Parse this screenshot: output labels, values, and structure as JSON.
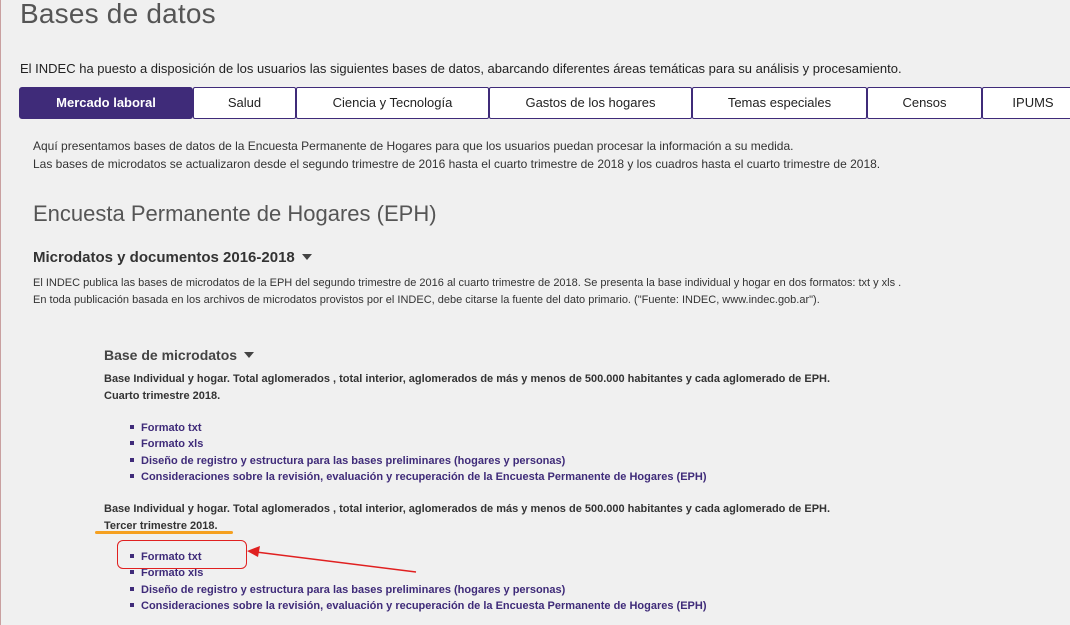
{
  "page": {
    "title": "Bases de datos",
    "intro": "El INDEC ha puesto a disposición de los usuarios las siguientes bases de datos, abarcando diferentes áreas temáticas para su análisis y procesamiento."
  },
  "tabs": [
    {
      "label": "Mercado laboral",
      "active": true
    },
    {
      "label": "Salud"
    },
    {
      "label": "Ciencia y Tecnología"
    },
    {
      "label": "Gastos de los hogares"
    },
    {
      "label": "Temas especiales"
    },
    {
      "label": "Censos"
    },
    {
      "label": "IPUMS"
    }
  ],
  "lead": {
    "line1": "Aquí presentamos bases de datos de la Encuesta Permanente de Hogares para que los usuarios puedan procesar la información a su medida.",
    "line2": "Las bases de microdatos se actualizaron desde el segundo trimestre de 2016 hasta el cuarto trimestre de 2018 y los cuadros hasta el cuarto trimestre de 2018."
  },
  "section": {
    "title": "Encuesta Permanente de Hogares (EPH)",
    "subsection_title": "Microdatos y documentos 2016-2018",
    "subsection_desc": "El INDEC publica las bases de microdatos de la EPH del segundo trimestre de 2016 al cuarto trimestre de 2018. Se presenta la base individual y hogar en dos formatos: txt y xls . En toda publicación basada en los archivos de microdatos provistos por el INDEC, debe citarse la fuente del dato primario. (\"Fuente: INDEC, www.indec.gob.ar\")."
  },
  "microdatos": {
    "heading": "Base de microdatos",
    "blocks": [
      {
        "description": "Base Individual y hogar. Total aglomerados , total interior, aglomerados de más y menos de 500.000 habitantes y cada aglomerado de EPH.",
        "period": "Cuarto trimestre 2018.",
        "links": [
          "Formato txt",
          "Formato xls",
          "Diseño de registro y estructura para las bases preliminares (hogares y personas)",
          "Consideraciones sobre la revisión, evaluación y recuperación de la Encuesta Permanente de Hogares (EPH)"
        ]
      },
      {
        "description": "Base Individual y hogar. Total aglomerados , total interior, aglomerados de más y menos de 500.000 habitantes y cada aglomerado de EPH.",
        "period": "Tercer trimestre 2018.",
        "links": [
          "Formato txt",
          "Formato xls",
          "Diseño de registro y estructura para las bases preliminares (hogares y personas)",
          "Consideraciones sobre la revisión, evaluación y recuperación de la Encuesta Permanente de Hogares (EPH)"
        ]
      }
    ]
  },
  "annotation_colors": {
    "underline": "#f5a020",
    "box": "#e02020",
    "arrow": "#e02020"
  },
  "accent_color": "#3f2b79"
}
